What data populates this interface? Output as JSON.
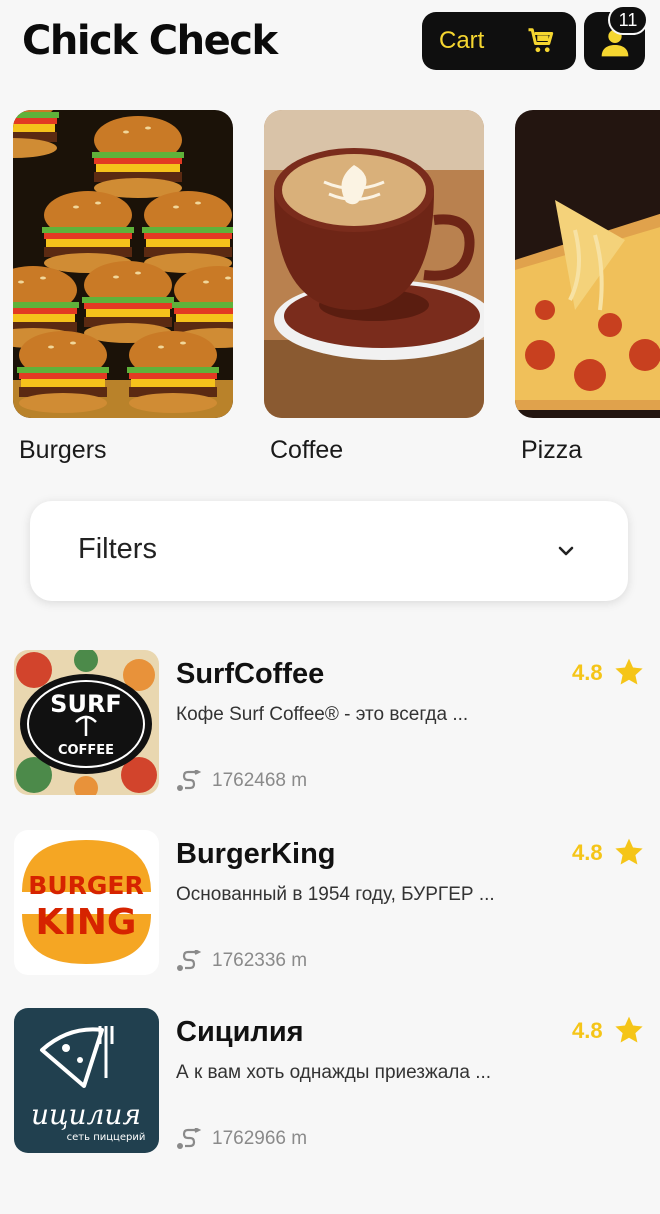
{
  "header": {
    "title": "Chick Check",
    "cart_label": "Cart",
    "cart_icon": "cart-icon",
    "profile_icon": "user-icon",
    "notification_count": "11",
    "accent_color": "#f5d630"
  },
  "categories": [
    {
      "label": "Burgers",
      "image": "burgers-photo"
    },
    {
      "label": "Coffee",
      "image": "coffee-photo"
    },
    {
      "label": "Pizza",
      "image": "pizza-photo"
    }
  ],
  "filters": {
    "label": "Filters",
    "icon": "chevron-down-icon"
  },
  "shops": [
    {
      "name": "SurfCoffee",
      "description": "Кофе Surf Coffee® - это всегда ...",
      "distance": "1762468 m",
      "rating": "4.8",
      "logo": "surf-coffee-logo"
    },
    {
      "name": "BurgerKing",
      "description": "Основанный в 1954 году, БУРГЕР ...",
      "distance": "1762336 m",
      "rating": "4.8",
      "logo": "burger-king-logo"
    },
    {
      "name": "Сицилия",
      "description": "А к вам хоть однажды приезжала ...",
      "distance": "1762966 m",
      "rating": "4.8",
      "logo": "sicilia-logo"
    }
  ],
  "logos": {
    "surf_top": "SURF",
    "surf_bottom": "COFFEE",
    "bk_top": "BURGER",
    "bk_bottom": "KING",
    "sicilia_name": "ицилия",
    "sicilia_sub": "сеть пиццерий"
  }
}
